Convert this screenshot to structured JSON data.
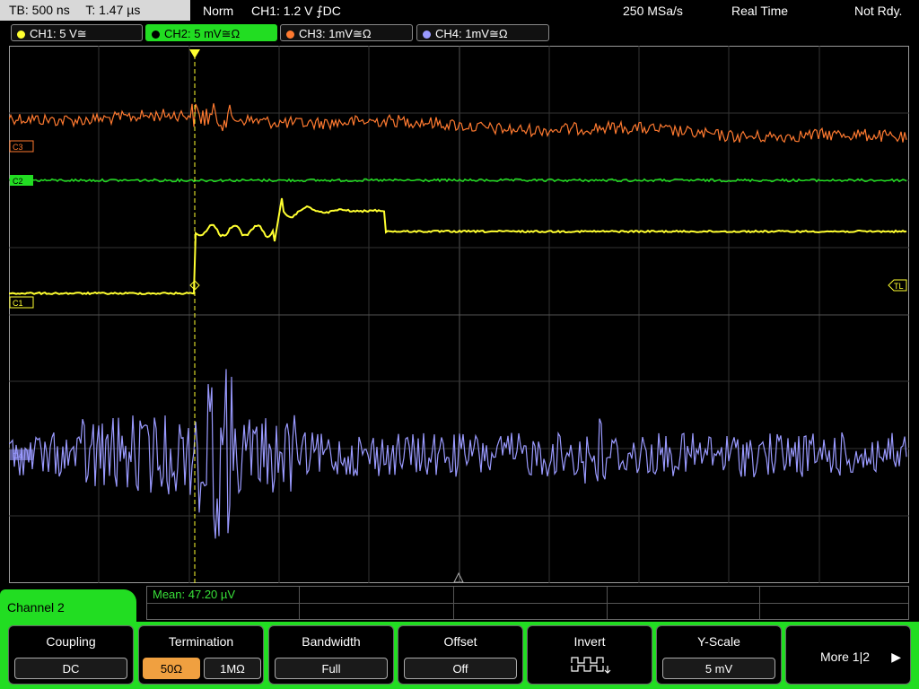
{
  "status_bar": {
    "timebase": "TB: 500 ns",
    "trigger_time": "T: 1.47 µs",
    "trigger_mode": "Norm",
    "trigger_info": "CH1: 1.2 V ⨍DC",
    "sample_rate": "250 MSa/s",
    "acq_mode": "Real Time",
    "state": "Not Rdy."
  },
  "channels": [
    {
      "label": "CH1: 5 V≅",
      "color": "#ffff30"
    },
    {
      "label": "CH2: 5 mV≅Ω",
      "color": "#22dd22"
    },
    {
      "label": "CH3: 1mV≅Ω",
      "color": "#ff7a30"
    },
    {
      "label": "CH4: 1mV≅Ω",
      "color": "#9a9aff"
    }
  ],
  "markers": {
    "c3": "C3",
    "c2": "C2",
    "c1": "C1",
    "c4": "C4",
    "tl": "TL"
  },
  "readout": {
    "mean": "Mean: 47.20 µV"
  },
  "menu": {
    "title": "Channel 2",
    "coupling": {
      "title": "Coupling",
      "value": "DC"
    },
    "termination": {
      "title": "Termination",
      "opt1": "50Ω",
      "opt2": "1MΩ"
    },
    "bandwidth": {
      "title": "Bandwidth",
      "value": "Full"
    },
    "offset": {
      "title": "Offset",
      "value": "Off"
    },
    "invert": {
      "title": "Invert"
    },
    "yscale": {
      "title": "Y-Scale",
      "value": "5 mV"
    },
    "more": {
      "label": "More 1|2",
      "arrow": "▶"
    }
  }
}
